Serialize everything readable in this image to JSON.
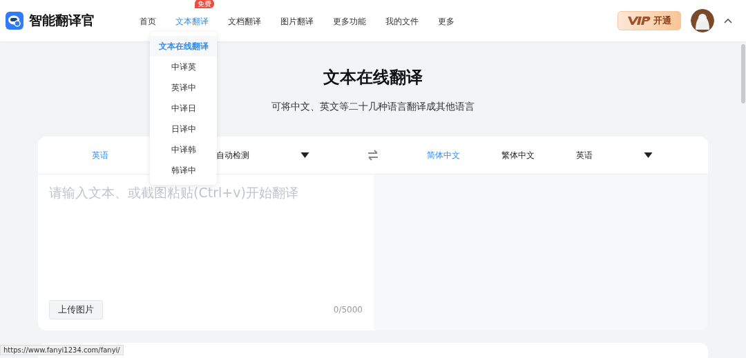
{
  "brand": {
    "name": "智能翻译官"
  },
  "nav": [
    {
      "label": "首页",
      "selected": false
    },
    {
      "label": "文本翻译",
      "selected": true,
      "badge": "免费"
    },
    {
      "label": "文档翻译",
      "selected": false
    },
    {
      "label": "图片翻译",
      "selected": false
    },
    {
      "label": "更多功能",
      "selected": false
    },
    {
      "label": "我的文件",
      "selected": false
    },
    {
      "label": "更多",
      "selected": false
    }
  ],
  "vip_button": {
    "label": "开通"
  },
  "dropdown": [
    {
      "label": "文本在线翻译",
      "selected": true
    },
    {
      "label": "中译英",
      "selected": false
    },
    {
      "label": "英译中",
      "selected": false
    },
    {
      "label": "中译日",
      "selected": false
    },
    {
      "label": "日译中",
      "selected": false
    },
    {
      "label": "中译韩",
      "selected": false
    },
    {
      "label": "韩译中",
      "selected": false
    }
  ],
  "heading": {
    "title": "文本在线翻译",
    "subtitle": "可将中文、英文等二十几种语言翻译成其他语言"
  },
  "source_langs": [
    {
      "label": "英语",
      "selected": true
    },
    {
      "label": "自动检测",
      "selected": false
    }
  ],
  "target_langs": [
    {
      "label": "简体中文",
      "selected": true
    },
    {
      "label": "繁体中文",
      "selected": false
    },
    {
      "label": "英语",
      "selected": false
    }
  ],
  "input": {
    "placeholder": "请输入文本、或截图粘贴(Ctrl+v)开始翻译",
    "upload_button": "上传图片",
    "count": "0/5000"
  },
  "status_bar": {
    "url": "https://www.fanyi1234.com/fanyi/"
  }
}
